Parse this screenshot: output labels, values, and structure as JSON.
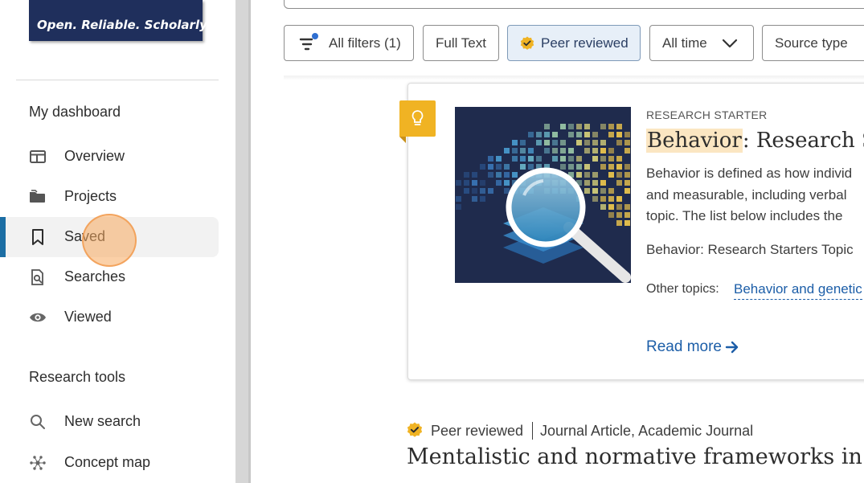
{
  "sidebar": {
    "logo_tagline": "Open. Reliable. Scholarly.",
    "dashboard_heading": "My dashboard",
    "dashboard_items": [
      {
        "label": "Overview",
        "icon": "layout-icon"
      },
      {
        "label": "Projects",
        "icon": "folder-icon"
      },
      {
        "label": "Saved",
        "icon": "bookmark-icon",
        "active": true
      },
      {
        "label": "Searches",
        "icon": "saved-search-icon"
      },
      {
        "label": "Viewed",
        "icon": "eye-icon"
      }
    ],
    "tools_heading": "Research tools",
    "tools_items": [
      {
        "label": "New search",
        "icon": "search-icon"
      },
      {
        "label": "Concept map",
        "icon": "concept-map-icon"
      }
    ]
  },
  "filters": {
    "all_filters": "All filters (1)",
    "full_text": "Full Text",
    "peer_reviewed": "Peer reviewed",
    "all_time": "All time",
    "source_type": "Source type"
  },
  "starter": {
    "label": "RESEARCH STARTER",
    "title_highlight": "Behavior",
    "title_rest": ": Research St",
    "desc_lines": [
      "Behavior is defined as how individ",
      "and measurable, including verbal",
      "topic. The list below includes the"
    ],
    "subtopics": "Behavior: Research Starters Topic",
    "other_topics_label": "Other topics:",
    "other_topics_link": "Behavior and genetic",
    "read_more": "Read more"
  },
  "result": {
    "peer_reviewed": "Peer reviewed",
    "type": "Journal Article, Academic Journal",
    "title": "Mentalistic and normative frameworks in chil"
  },
  "colors": {
    "accent_blue": "#1c6ea4",
    "link_blue": "#1c5ea8",
    "badge_gold": "#f0b323",
    "logo_navy": "#1f2f5c",
    "highlight": "#fbe6c2",
    "click_indicator": "#f7a95f"
  }
}
